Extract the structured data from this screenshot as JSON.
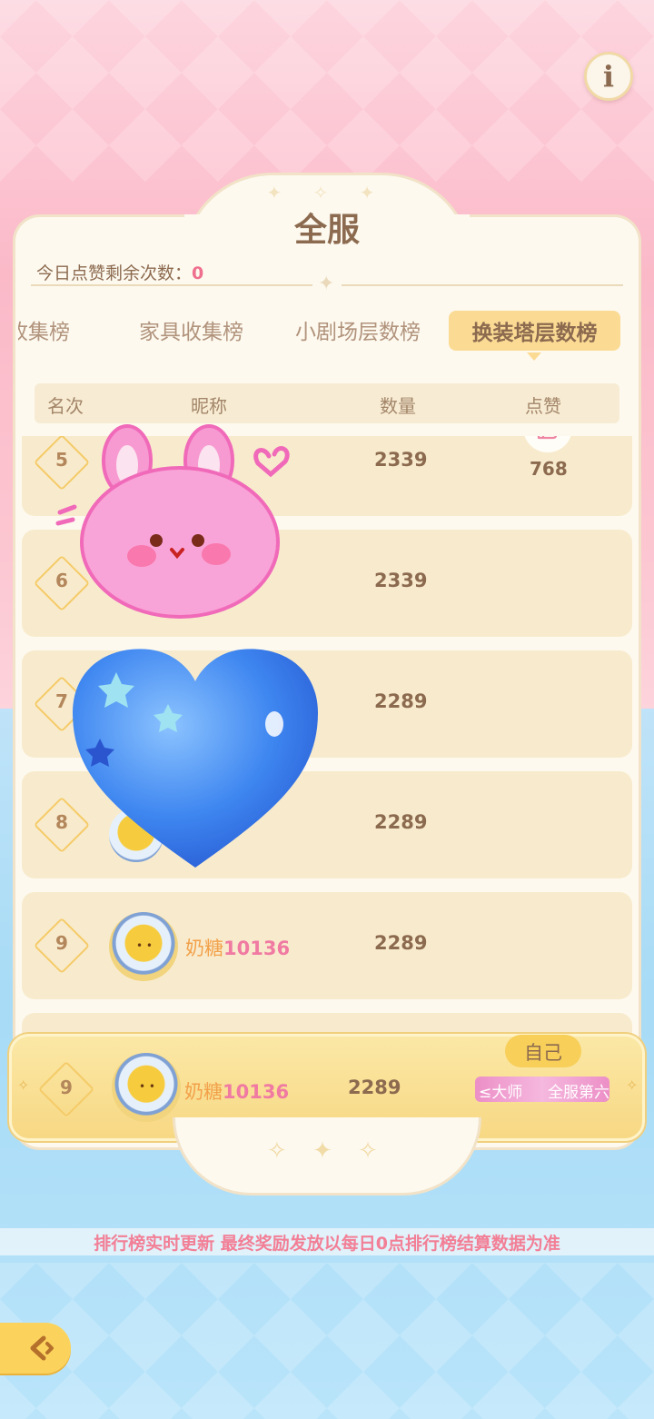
{
  "header": {
    "info_icon": "info-icon"
  },
  "panel": {
    "title": "全服",
    "likes_remaining_label": "今日点赞剩余次数：",
    "likes_remaining_value": "0"
  },
  "tabs": [
    {
      "label": "收集榜",
      "active": false
    },
    {
      "label": "家具收集榜",
      "active": false
    },
    {
      "label": "小剧场层数榜",
      "active": false
    },
    {
      "label": "换装塔层数榜",
      "active": true
    }
  ],
  "columns": {
    "rank": "名次",
    "nickname": "昵称",
    "count": "数量",
    "like": "点赞"
  },
  "rows": [
    {
      "rank": "5",
      "nickname": "",
      "count": "2339",
      "like_count": "768"
    },
    {
      "rank": "6",
      "nickname": "",
      "count": "2339"
    },
    {
      "rank": "7",
      "nickname": "",
      "count": "2289"
    },
    {
      "rank": "8",
      "nickname": "",
      "count": "2289"
    },
    {
      "rank": "9",
      "nickname_prefix": "奶糖",
      "nickname_digits": "10136",
      "count": "2289"
    }
  ],
  "self_row": {
    "badge": "自己",
    "rank": "9",
    "nickname_prefix": "奶糖",
    "nickname_digits": "10136",
    "count": "2289",
    "title_part1": "≤大师",
    "title_part2": "全服第六"
  },
  "notice": "排行榜实时更新 最终奖励发放以每日0点排行榜结算数据为准",
  "colors": {
    "accent": "#fbdb94",
    "pink_text": "#f27f96",
    "brown_text": "#8c6a4f"
  }
}
